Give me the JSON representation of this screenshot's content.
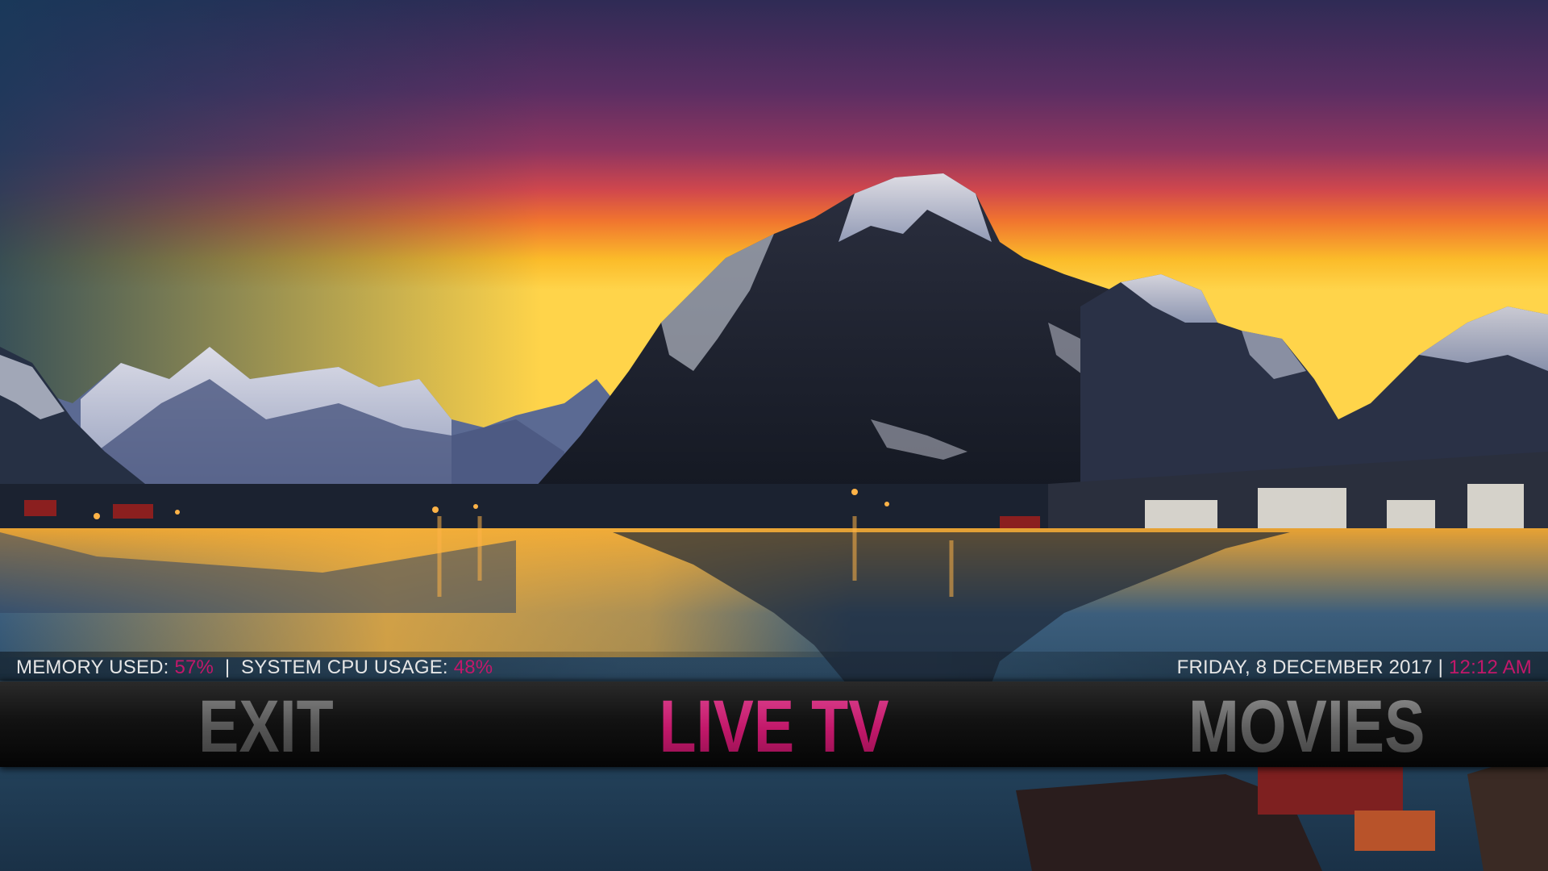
{
  "status": {
    "memory_label": "MEMORY USED:",
    "memory_value": "57%",
    "separator": "|",
    "cpu_label": "SYSTEM CPU USAGE:",
    "cpu_value": "48%",
    "date": "FRIDAY, 8 DECEMBER 2017",
    "date_separator": "|",
    "time": "12:12 AM"
  },
  "menu": {
    "items": [
      {
        "label": "EXIT",
        "selected": false
      },
      {
        "label": "LIVE TV",
        "selected": true
      },
      {
        "label": "MOVIES",
        "selected": false
      }
    ]
  },
  "colors": {
    "accent": "#c2186a",
    "status_text": "#e6e6e6",
    "menu_inactive": "#5a5a5a",
    "menu_band": "#0e0e0e"
  },
  "background": {
    "subject": "mountain-lake-sunset-wallpaper"
  }
}
